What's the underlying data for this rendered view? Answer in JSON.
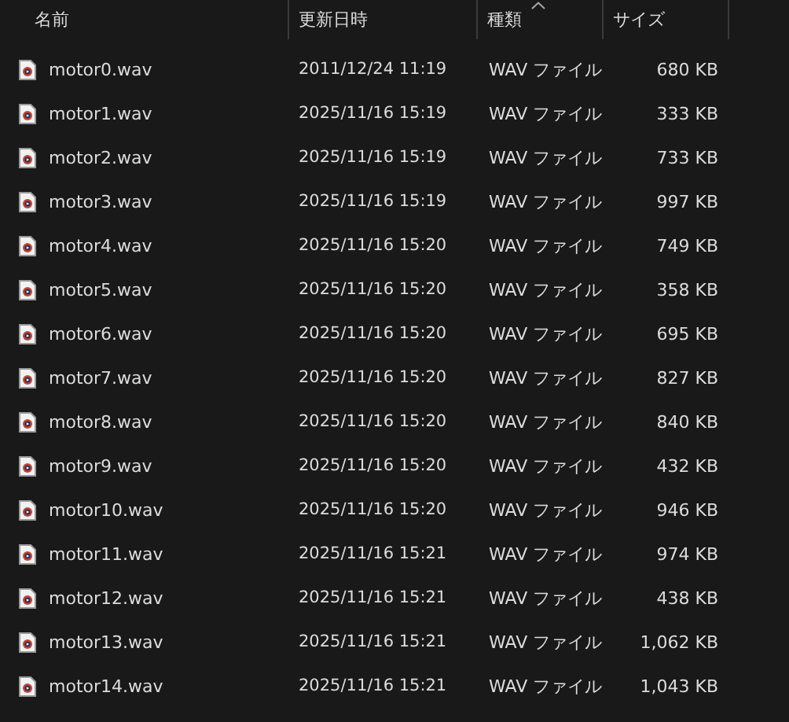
{
  "columns": [
    {
      "label": "名前",
      "sorted": false
    },
    {
      "label": "更新日時",
      "sorted": false
    },
    {
      "label": "種類",
      "sorted": true
    },
    {
      "label": "サイズ",
      "sorted": false
    }
  ],
  "files": [
    {
      "name": "motor0.wav",
      "modified": "2011/12/24 11:19",
      "type": "WAV ファイル",
      "size": "680 KB"
    },
    {
      "name": "motor1.wav",
      "modified": "2025/11/16 15:19",
      "type": "WAV ファイル",
      "size": "333 KB"
    },
    {
      "name": "motor2.wav",
      "modified": "2025/11/16 15:19",
      "type": "WAV ファイル",
      "size": "733 KB"
    },
    {
      "name": "motor3.wav",
      "modified": "2025/11/16 15:19",
      "type": "WAV ファイル",
      "size": "997 KB"
    },
    {
      "name": "motor4.wav",
      "modified": "2025/11/16 15:20",
      "type": "WAV ファイル",
      "size": "749 KB"
    },
    {
      "name": "motor5.wav",
      "modified": "2025/11/16 15:20",
      "type": "WAV ファイル",
      "size": "358 KB"
    },
    {
      "name": "motor6.wav",
      "modified": "2025/11/16 15:20",
      "type": "WAV ファイル",
      "size": "695 KB"
    },
    {
      "name": "motor7.wav",
      "modified": "2025/11/16 15:20",
      "type": "WAV ファイル",
      "size": "827 KB"
    },
    {
      "name": "motor8.wav",
      "modified": "2025/11/16 15:20",
      "type": "WAV ファイル",
      "size": "840 KB"
    },
    {
      "name": "motor9.wav",
      "modified": "2025/11/16 15:20",
      "type": "WAV ファイル",
      "size": "432 KB"
    },
    {
      "name": "motor10.wav",
      "modified": "2025/11/16 15:20",
      "type": "WAV ファイル",
      "size": "946 KB"
    },
    {
      "name": "motor11.wav",
      "modified": "2025/11/16 15:21",
      "type": "WAV ファイル",
      "size": "974 KB"
    },
    {
      "name": "motor12.wav",
      "modified": "2025/11/16 15:21",
      "type": "WAV ファイル",
      "size": "438 KB"
    },
    {
      "name": "motor13.wav",
      "modified": "2025/11/16 15:21",
      "type": "WAV ファイル",
      "size": "1,062 KB"
    },
    {
      "name": "motor14.wav",
      "modified": "2025/11/16 15:21",
      "type": "WAV ファイル",
      "size": "1,043 KB"
    }
  ]
}
